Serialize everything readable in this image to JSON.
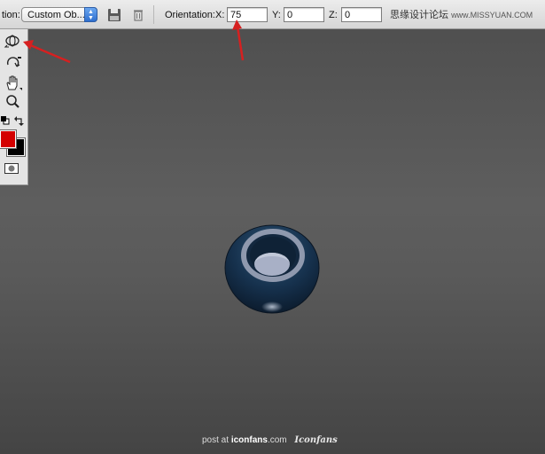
{
  "options_bar": {
    "position_label": "tion:",
    "preset_value": "Custom Ob...",
    "orientation_label": "Orientation:",
    "x_label": "X:",
    "x_value": "75",
    "y_label": "Y:",
    "y_value": "0",
    "z_label": "Z:",
    "z_value": "0"
  },
  "watermark": {
    "cn": "思缘设计论坛",
    "en": "www.MISSYUAN.COM"
  },
  "toolbox": {
    "tools": [
      "object-rotate-icon",
      "object-roll-icon",
      "pan-hand-icon",
      "zoom-icon"
    ],
    "foreground_color": "#d40000",
    "background_color": "#000000"
  },
  "credit": {
    "prefix": "post at",
    "site": "iconfans",
    "suffix": ".com",
    "logo": "Iconfans"
  },
  "colors": {
    "annotation_arrow": "#d62020",
    "object_body": "#1b3550",
    "object_inner": "#a8b0c6"
  }
}
